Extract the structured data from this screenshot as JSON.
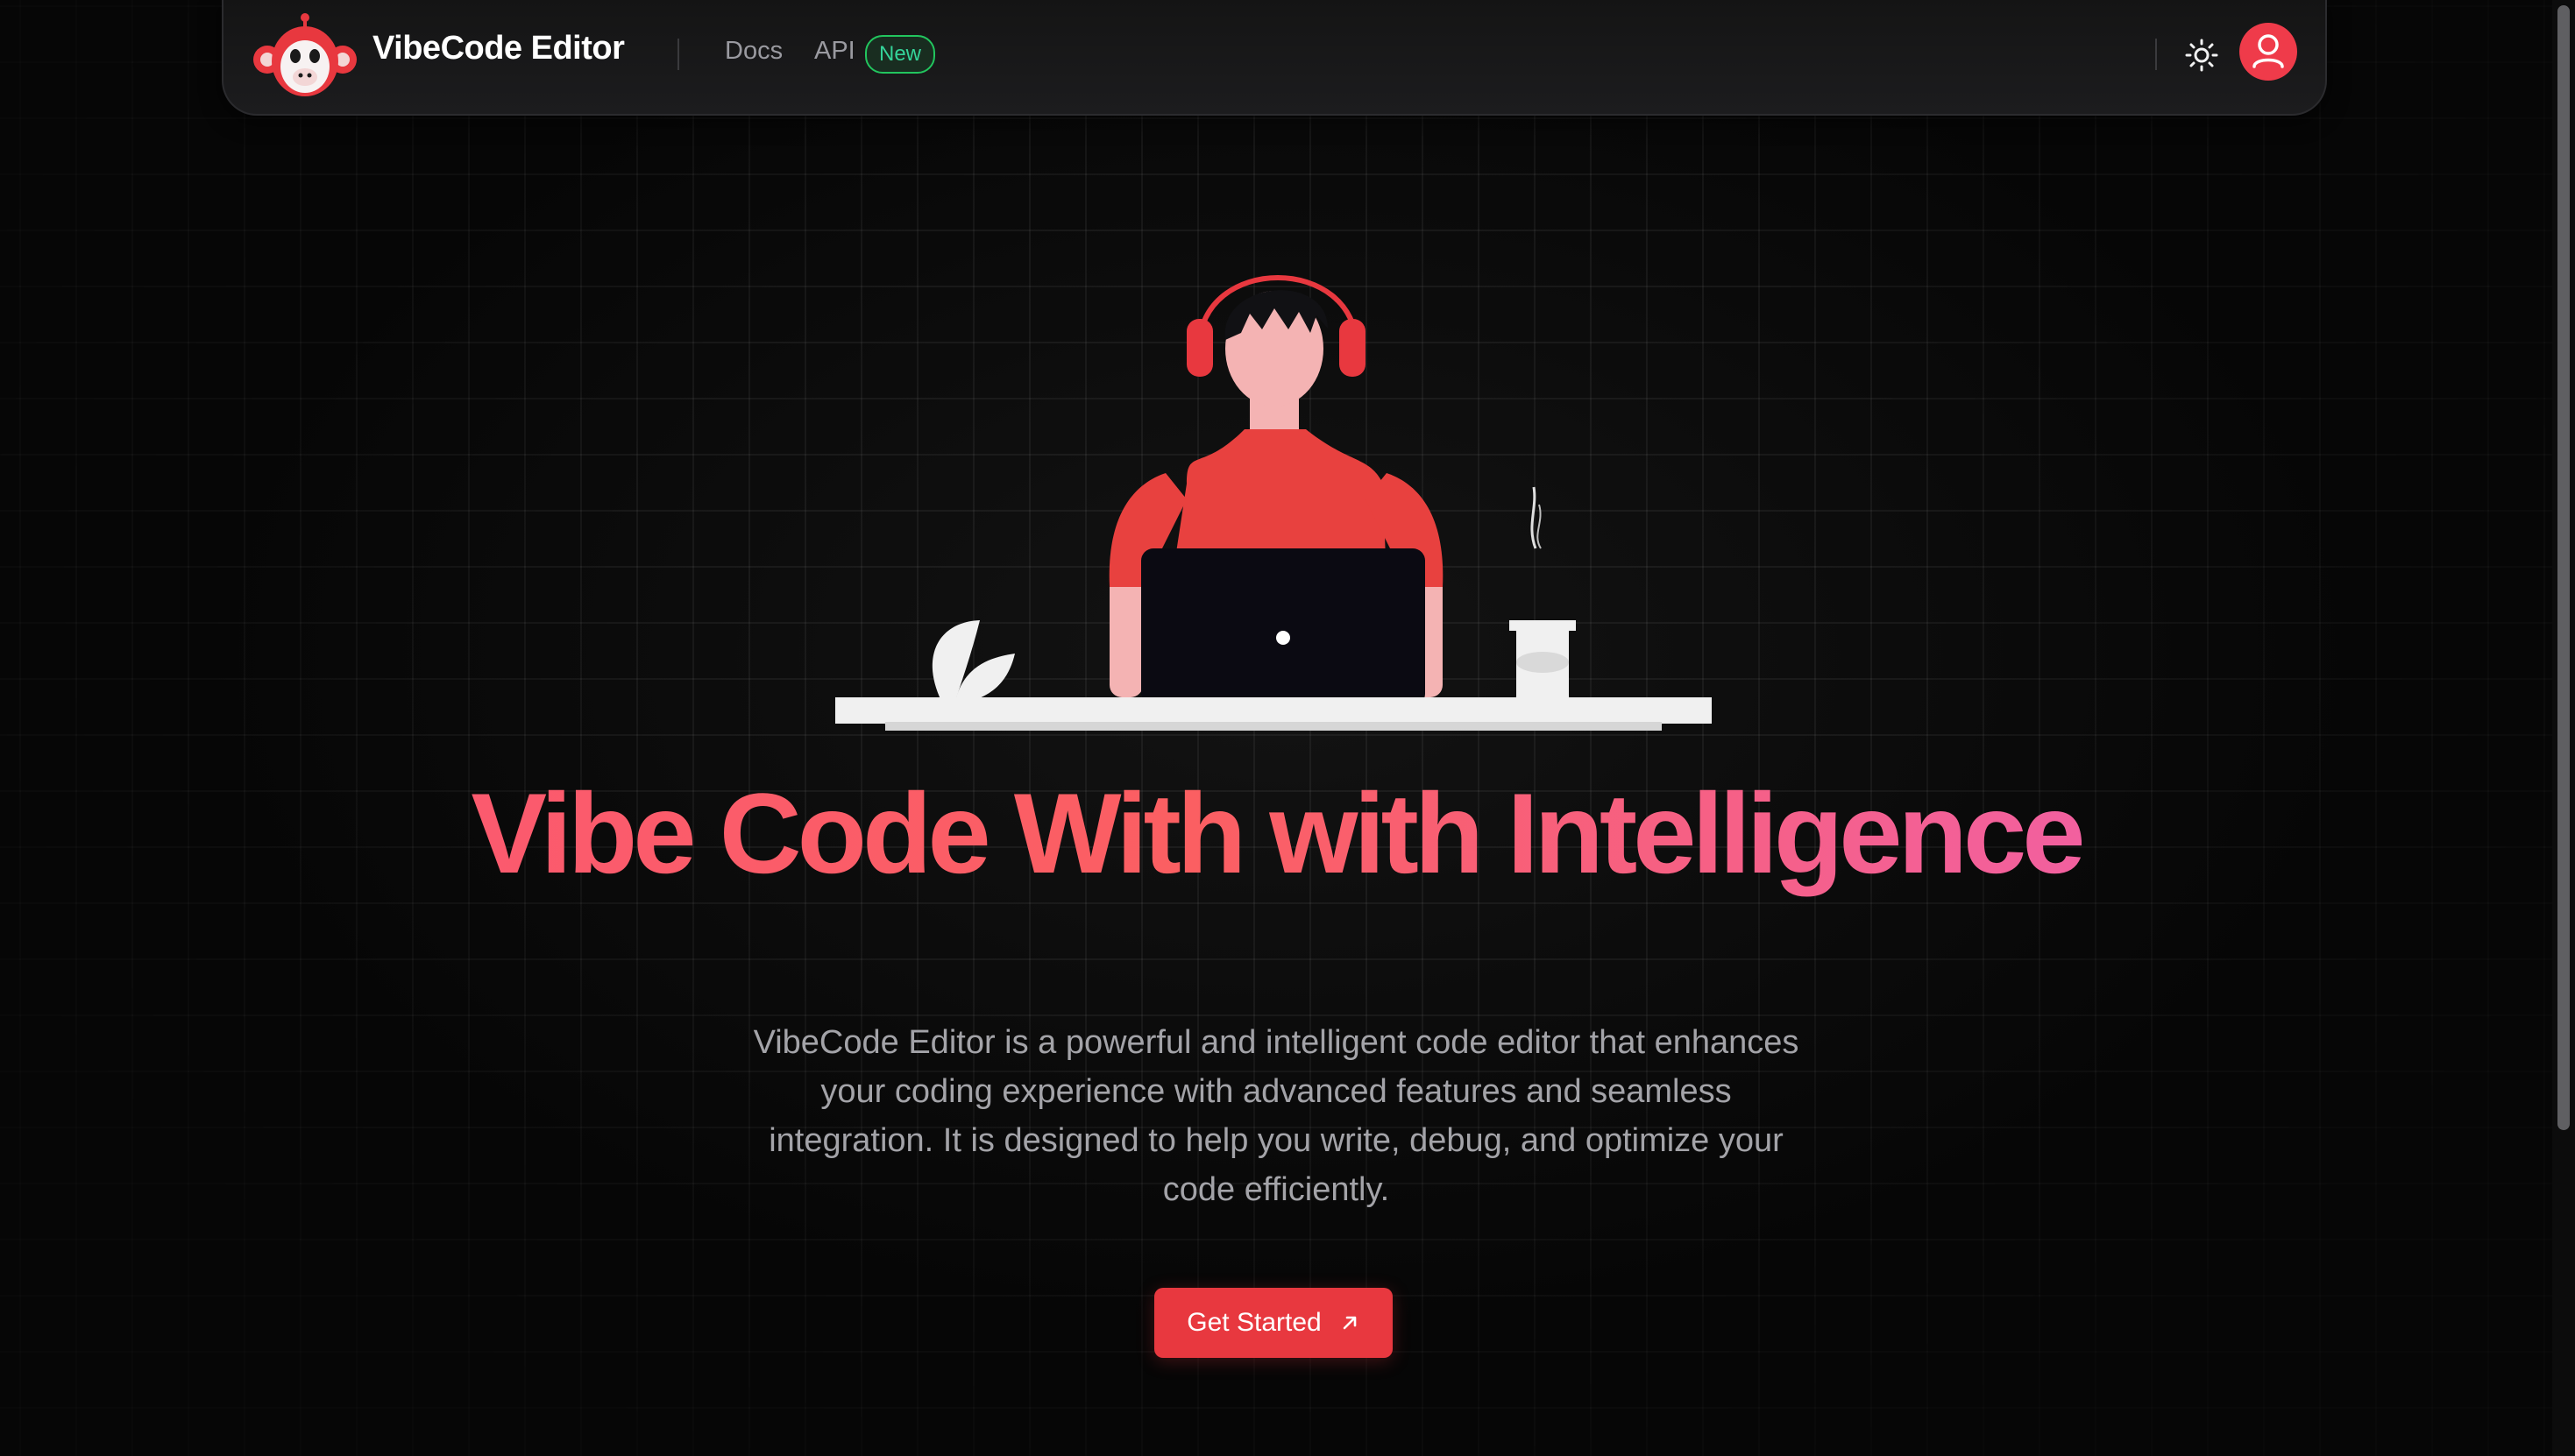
{
  "navbar": {
    "brand": "VibeCode Editor",
    "links": {
      "docs": "Docs",
      "api": "API"
    },
    "api_badge": "New",
    "icons": {
      "logo": "monkey-logo-icon",
      "theme_toggle": "sun-icon",
      "profile": "user-icon"
    }
  },
  "hero": {
    "headline": "Vibe Code With with Intelligence",
    "description": "VibeCode Editor is a powerful and intelligent code editor that enhances your coding experience with advanced features and seamless integration. It is designed to help you write, debug, and optimize your code efficiently.",
    "cta_label": "Get Started",
    "cta_icon": "arrow-up-right-icon"
  },
  "colors": {
    "background": "#060606",
    "accent": "#e8383f",
    "headline_gradient_start": "#fb5a6e",
    "headline_gradient_end": "#f2609f",
    "badge_green": "#22c55e"
  }
}
